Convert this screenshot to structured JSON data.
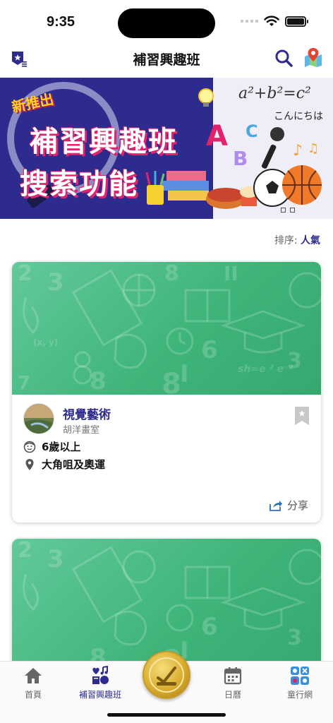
{
  "status_bar": {
    "time": "9:35"
  },
  "header": {
    "title": "補習興趣班"
  },
  "banner": {
    "tag": "新推出",
    "line1": "補習興趣班",
    "line2": "搜索功能",
    "math_text": "a²+b²=c²",
    "japanese_text": "こんにちは",
    "letters": [
      "A",
      "B",
      "C"
    ]
  },
  "sort": {
    "label": "排序:",
    "value": "人氣"
  },
  "cards": [
    {
      "title": "視覺藝術",
      "organization": "胡洋畫室",
      "age": "6歲以上",
      "location": "大角咀及奧運",
      "share_label": "分享"
    }
  ],
  "tabs": [
    {
      "label": "首頁",
      "icon": "home-icon"
    },
    {
      "label": "補習興趣班",
      "icon": "class-icon",
      "active": true
    },
    {
      "label": "日曆",
      "icon": "calendar-icon"
    },
    {
      "label": "童行網",
      "icon": "network-icon"
    }
  ],
  "colors": {
    "brand": "#2e2b8f",
    "accent": "#e2236c",
    "card_green": "#4cbc86"
  }
}
